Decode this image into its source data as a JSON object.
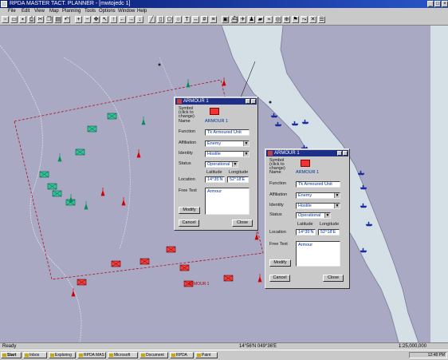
{
  "window": {
    "title": "RPDA MASTER TACT. PLANNER - [mwtojedc 1]"
  },
  "menu": [
    "File",
    "Edit",
    "View",
    "Map",
    "Planning",
    "Tools",
    "Options",
    "Window",
    "Help"
  ],
  "toolbar": {
    "icons": [
      "new-icon",
      "open-icon",
      "save-icon",
      "print-icon",
      "cut-icon",
      "copy-icon",
      "paste-icon",
      "undo-icon",
      "zoom-in-icon",
      "zoom-out-icon",
      "pan-icon",
      "select-icon",
      "arrow-up-icon",
      "arrow-left-icon",
      "arrow-right-icon",
      "arrow-down-icon",
      "line-icon",
      "rect-icon",
      "polygon-icon",
      "circle-icon",
      "text-icon",
      "measure-icon",
      "grid-icon",
      "layer-icon",
      "unit-icon",
      "ship-icon",
      "aircraft-icon",
      "soldier-icon",
      "tank-icon",
      "radio-icon",
      "radar-icon",
      "target-icon",
      "flag-icon",
      "route-icon",
      "delete-icon",
      "properties-icon"
    ]
  },
  "map": {
    "sea_color": "#d4dfe6",
    "land_color": "#aaa9c4",
    "unit_labels": [
      "ARMOUR 1"
    ]
  },
  "dialog1": {
    "title": "ARMOUR 1",
    "symbol_label": "Symbol (click to change)",
    "name_label": "Name",
    "name_value": "ARMOUR 1",
    "function_label": "Function",
    "function_value": "Tk Armoured Unit",
    "affiliation_label": "Affiliation",
    "affiliation_value": "Enemy",
    "identity_label": "Identity",
    "identity_value": "Hostile",
    "status_label": "Status",
    "status_value": "Operational",
    "latitude_label": "Latitude",
    "longitude_label": "Longitude",
    "location_label": "Location",
    "latitude_value": "14°35'N",
    "longitude_value": "52°18'E",
    "free_text_label": "Free Text",
    "free_text_value": "Armour",
    "modify_button": "Modify",
    "cancel_button": "Cancel",
    "close_button": "Close"
  },
  "dialog2": {
    "title": "ARMOUR 1",
    "symbol_label": "Symbol (click to change)",
    "name_label": "Name",
    "name_value": "ARMOUR 1",
    "function_label": "Function",
    "function_value": "Tk Armoured Unit",
    "affiliation_label": "Affiliation",
    "affiliation_value": "Enemy",
    "identity_label": "Identity",
    "identity_value": "Hostile",
    "status_label": "Status",
    "status_value": "Operational",
    "latitude_label": "Latitude",
    "longitude_label": "Longitude",
    "location_label": "Location",
    "latitude_value": "14°35'N",
    "longitude_value": "52°18'E",
    "free_text_label": "Free Text",
    "free_text_value": "Armour",
    "modify_button": "Modify",
    "cancel_button": "Cancel",
    "close_button": "Close"
  },
  "statusbar": {
    "left": "Ready",
    "middle": "14°56'N 049°36'E",
    "right": "1:25,000,000"
  },
  "taskbar": {
    "start": "Start",
    "items": [
      "Inbox",
      "Exploring",
      "RPDA MAS",
      "Microsoft",
      "Document",
      "RPDA",
      "Paint"
    ],
    "clock": "12:48 PM"
  }
}
